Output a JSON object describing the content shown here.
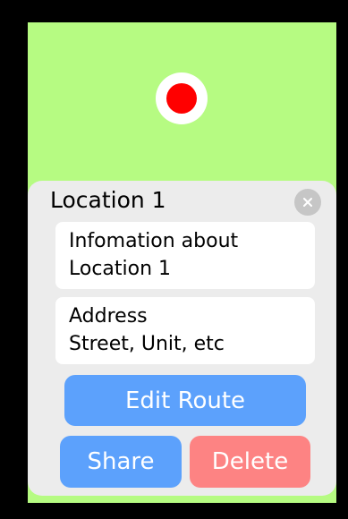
{
  "map": {
    "marker_icon": "location-pin-icon",
    "marker_color": "#ff0000",
    "background_color": "#b6fb82"
  },
  "panel": {
    "title": "Location 1",
    "close_icon": "close-icon",
    "info_lines": [
      "Infomation about",
      "Location 1"
    ],
    "address_lines": [
      "Address",
      "Street, Unit, etc"
    ]
  },
  "actions": {
    "edit_route_label": "Edit Route",
    "share_label": "Share",
    "delete_label": "Delete",
    "primary_color": "#5ca1fc",
    "danger_color": "#fd8383"
  }
}
